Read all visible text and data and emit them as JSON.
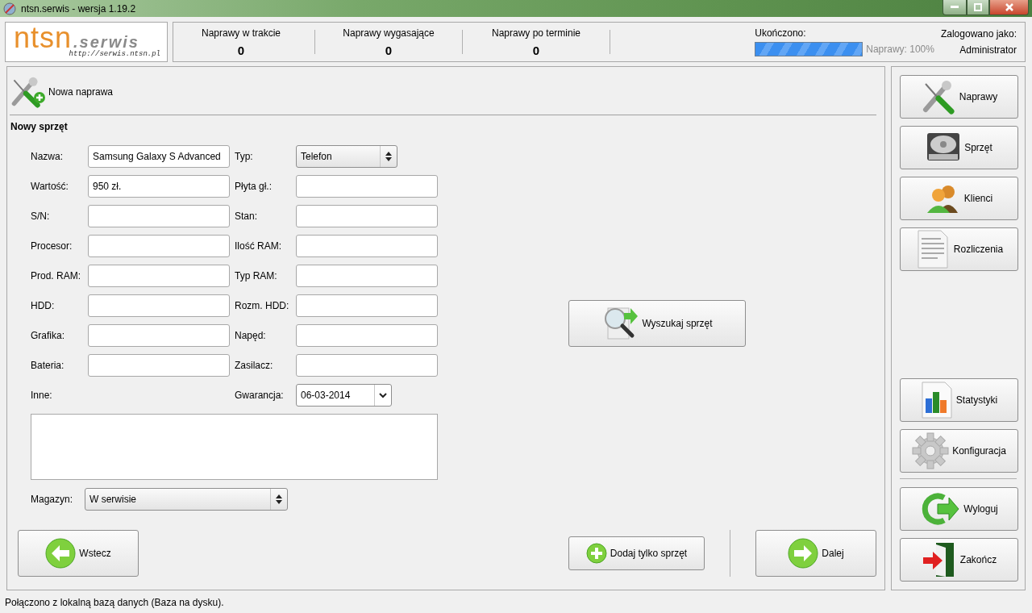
{
  "window": {
    "title": "ntsn.serwis - wersja 1.19.2"
  },
  "logo": {
    "name": "ntsn",
    "suffix": ".serwis",
    "url": "http://serwis.ntsn.pl"
  },
  "stats": [
    {
      "label": "Naprawy w trakcie",
      "value": "0"
    },
    {
      "label": "Naprawy wygasające",
      "value": "0"
    },
    {
      "label": "Naprawy po terminie",
      "value": "0"
    }
  ],
  "progress": {
    "label": "Ukończono:",
    "level": 1,
    "reading": "Naprawy: 100%"
  },
  "user": {
    "label": "Zalogowano jako:",
    "name": "Administrator"
  },
  "page": {
    "title": "Nowa naprawa",
    "section": "Nowy sprzęt"
  },
  "form": {
    "rows": [
      [
        {
          "label": "Nazwa:",
          "kind": "text",
          "value": "Samsung Galaxy S Advanced"
        },
        {
          "label": "Typ:",
          "kind": "select",
          "value": "Telefon"
        }
      ],
      [
        {
          "label": "Wartość:",
          "kind": "text",
          "value": "950 zł."
        },
        {
          "label": "Płyta gł.:",
          "kind": "text"
        }
      ],
      [
        {
          "label": "S/N:",
          "kind": "text"
        },
        {
          "label": "Stan:",
          "kind": "text"
        }
      ],
      [
        {
          "label": "Procesor:",
          "kind": "text"
        },
        {
          "label": "Ilość RAM:",
          "kind": "text"
        }
      ],
      [
        {
          "label": "Prod. RAM:",
          "kind": "text"
        },
        {
          "label": "Typ RAM:",
          "kind": "text"
        }
      ],
      [
        {
          "label": "HDD:",
          "kind": "text"
        },
        {
          "label": "Rozm. HDD:",
          "kind": "text"
        }
      ],
      [
        {
          "label": "Grafika:",
          "kind": "text"
        },
        {
          "label": "Napęd:",
          "kind": "text"
        }
      ],
      [
        {
          "label": "Bateria:",
          "kind": "text"
        },
        {
          "label": "Zasilacz:",
          "kind": "text"
        }
      ],
      [
        {
          "label": "Inne:",
          "kind": "label"
        },
        {
          "label": "Gwarancja:",
          "kind": "date",
          "value": "06-03-2014"
        }
      ]
    ],
    "magazyn": {
      "label": "Magazyn:",
      "value": "W serwisie"
    }
  },
  "search_button": "Wyszukaj sprzęt",
  "bottom_buttons": [
    {
      "label": "Wstecz",
      "kind": "large"
    },
    {
      "label": "Dodaj tylko sprzęt",
      "kind": "small"
    },
    {
      "label": "Dalej",
      "kind": "large"
    }
  ],
  "sidebar": {
    "groups": [
      [
        "Naprawy",
        "Sprzęt",
        "Klienci",
        "Rozliczenia"
      ],
      [
        "Statystyki",
        "Konfiguracja"
      ],
      [
        "Wyloguj",
        "Zakończ"
      ]
    ]
  },
  "status_bar": "Połączono z lokalną bazą danych (Baza na dysku)."
}
